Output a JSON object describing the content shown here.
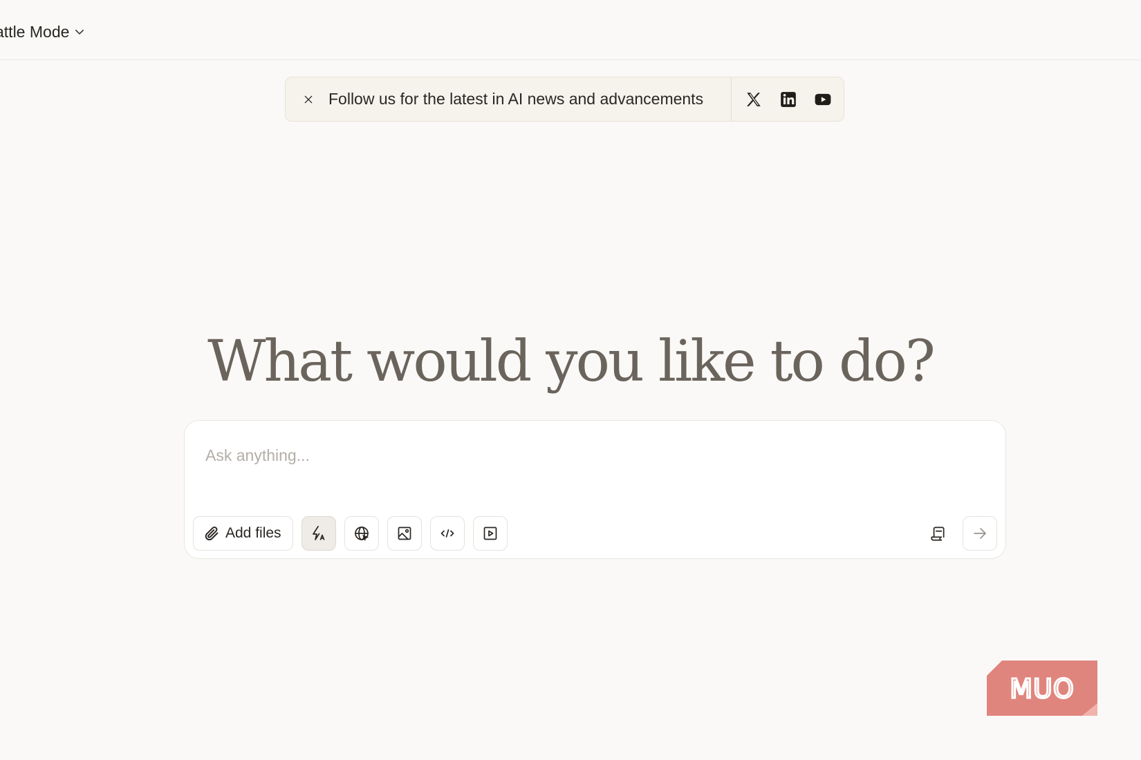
{
  "topbar": {
    "mode_label": "attle Mode",
    "mode_icon": "chevron-down-icon"
  },
  "banner": {
    "text": "Follow us for the latest in AI news and advancements",
    "close_icon": "close-icon",
    "socials": [
      "x-twitter-icon",
      "linkedin-icon",
      "youtube-icon"
    ]
  },
  "headline": "What would you like to do?",
  "composer": {
    "placeholder": "Ask anything...",
    "value": "",
    "add_files_label": "Add files",
    "tools": [
      {
        "icon": "lightning-auto-icon",
        "active": true
      },
      {
        "icon": "globe-icon",
        "active": false
      },
      {
        "icon": "image-icon",
        "active": false
      },
      {
        "icon": "code-icon",
        "active": false
      },
      {
        "icon": "video-play-icon",
        "active": false
      }
    ],
    "right_tools": [
      "prompt-library-icon",
      "send-arrow-icon"
    ]
  },
  "watermark": {
    "text": "MUO",
    "color": "#e0857d"
  },
  "colors": {
    "background": "#faf9f7",
    "banner_bg": "#f6f2ec",
    "headline": "#6b645c",
    "text": "#2a2622",
    "placeholder": "#b3aea8"
  }
}
